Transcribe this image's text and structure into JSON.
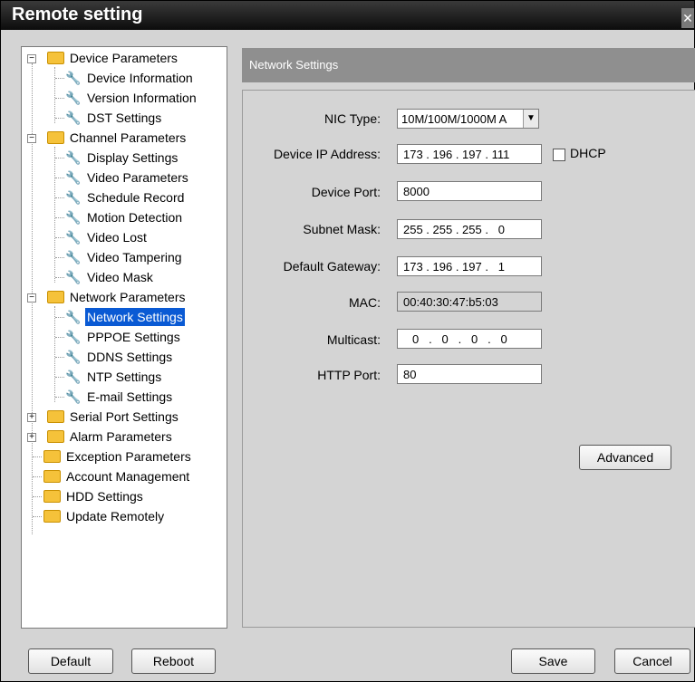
{
  "window": {
    "title": "Remote setting",
    "close_glyph": "✕"
  },
  "tree": {
    "device_parameters": "Device Parameters",
    "device_information": "Device Information",
    "version_information": "Version Information",
    "dst_settings": "DST Settings",
    "channel_parameters": "Channel Parameters",
    "display_settings": "Display Settings",
    "video_parameters": "Video Parameters",
    "schedule_record": "Schedule Record",
    "motion_detection": "Motion Detection",
    "video_lost": "Video Lost",
    "video_tampering": "Video Tampering",
    "video_mask": "Video Mask",
    "network_parameters": "Network Parameters",
    "network_settings": "Network Settings",
    "pppoe_settings": "PPPOE Settings",
    "ddns_settings": "DDNS Settings",
    "ntp_settings": "NTP Settings",
    "email_settings": "E-mail Settings",
    "serial_port_settings": "Serial Port Settings",
    "alarm_parameters": "Alarm Parameters",
    "exception_parameters": "Exception Parameters",
    "account_management": "Account Management",
    "hdd_settings": "HDD Settings",
    "update_remotely": "Update Remotely"
  },
  "content": {
    "header": "Network Settings",
    "nic_type_label": "NIC Type:",
    "nic_type_value": "10M/100M/1000M A",
    "device_ip_label": "Device IP Address:",
    "device_ip_value": "173 . 196 . 197 . 111",
    "dhcp_label": "DHCP",
    "device_port_label": "Device Port:",
    "device_port_value": "8000",
    "subnet_mask_label": "Subnet Mask:",
    "subnet_mask_value": "255 . 255 . 255 .   0",
    "default_gateway_label": "Default Gateway:",
    "default_gateway_value": "173 . 196 . 197 .   1",
    "mac_label": "MAC:",
    "mac_value": "00:40:30:47:b5:03",
    "multicast_label": "Multicast:",
    "multicast_value": "0   .   0   .   0   .   0",
    "http_port_label": "HTTP Port:",
    "http_port_value": "80",
    "advanced_label": "Advanced"
  },
  "footer": {
    "default_label": "Default",
    "reboot_label": "Reboot",
    "save_label": "Save",
    "cancel_label": "Cancel"
  }
}
